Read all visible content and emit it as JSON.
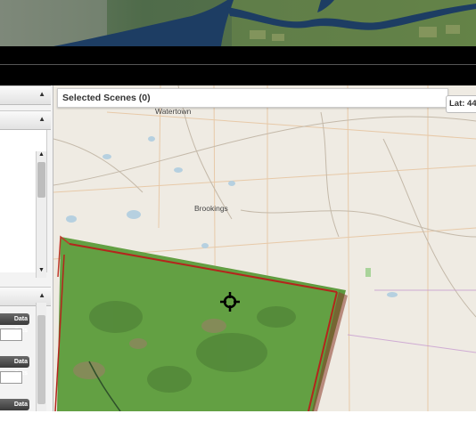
{
  "banner": {
    "name": "landsat-banner-image"
  },
  "left_panel": {
    "data_sets_buttons": [
      "Data Sets",
      "Data Sets",
      "Data Sets"
    ]
  },
  "map": {
    "header_title": "Selected Scenes (0)",
    "lat_readout": "Lat: 44.",
    "place_labels": [
      "Watertown",
      "Brookings"
    ]
  },
  "colors": {
    "scene_green": "#5e9a3e",
    "footprint_red": "#b4251c",
    "basemap": "#efebe3"
  }
}
